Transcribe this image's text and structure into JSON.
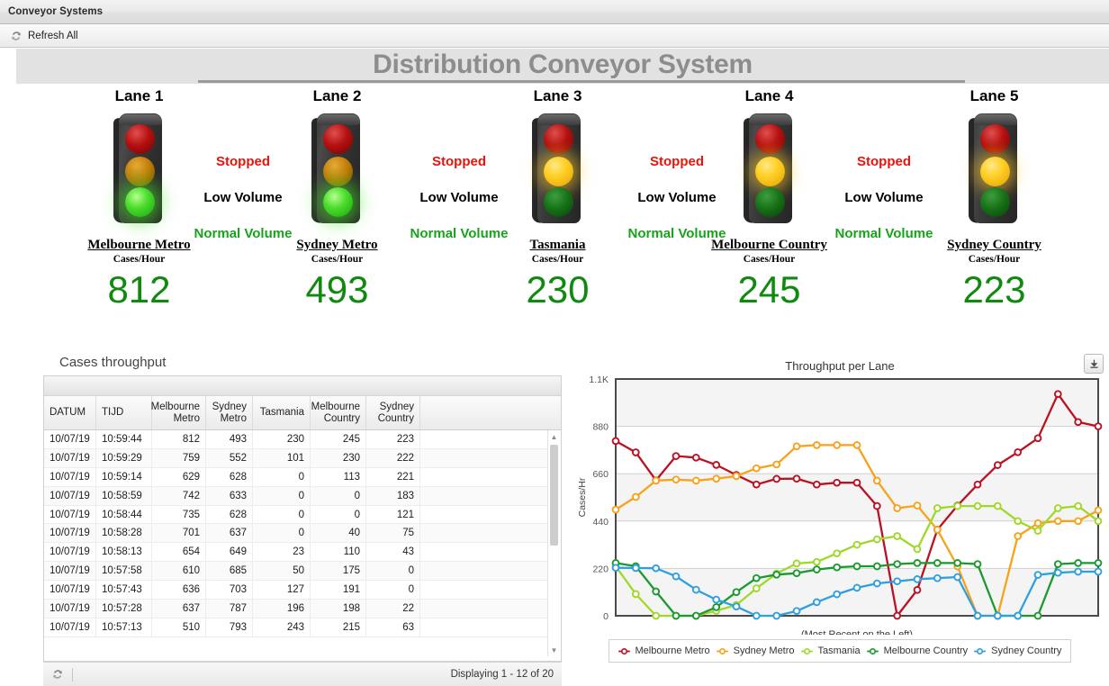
{
  "window": {
    "title": "Conveyor Systems"
  },
  "toolbar": {
    "refresh_all_label": "Refresh All",
    "refresh_icon": "refresh-icon"
  },
  "banner": {
    "title": "Distribution Conveyor System"
  },
  "lanes": [
    {
      "lane_label": "Lane 1",
      "name": "Melbourne Metro",
      "unit": "Cases/Hour",
      "value": "812",
      "signal": "green",
      "statuses": {
        "stopped": "Stopped",
        "low": "Low Volume",
        "normal": "Normal Volume"
      }
    },
    {
      "lane_label": "Lane 2",
      "name": "Sydney Metro",
      "unit": "Cases/Hour",
      "value": "493",
      "signal": "green",
      "statuses": {
        "stopped": "Stopped",
        "low": "Low Volume",
        "normal": "Normal Volume"
      }
    },
    {
      "lane_label": "Lane 3",
      "name": "Tasmania",
      "unit": "Cases/Hour",
      "value": "230",
      "signal": "amber",
      "statuses": {
        "stopped": "Stopped",
        "low": "Low Volume",
        "normal": "Normal Volume"
      }
    },
    {
      "lane_label": "Lane 4",
      "name": "Melbourne Country",
      "unit": "Cases/Hour",
      "value": "245",
      "signal": "amber",
      "statuses": {
        "stopped": "Stopped",
        "low": "Low Volume",
        "normal": "Normal Volume"
      }
    },
    {
      "lane_label": "Lane 5",
      "name": "Sydney Country",
      "unit": "Cases/Hour",
      "value": "223",
      "signal": "amber",
      "statuses": {
        "stopped": "Stopped",
        "low": "Low Volume",
        "normal": "Normal Volume"
      }
    }
  ],
  "grid": {
    "title": "Cases throughput",
    "columns": [
      "DATUM",
      "TIJD",
      "Melbourne Metro",
      "Sydney Metro",
      "Tasmania",
      "Melbourne Country",
      "Sydney Country"
    ],
    "rows": [
      [
        "10/07/19",
        "10:59:44",
        "812",
        "493",
        "230",
        "245",
        "223"
      ],
      [
        "10/07/19",
        "10:59:29",
        "759",
        "552",
        "101",
        "230",
        "222"
      ],
      [
        "10/07/19",
        "10:59:14",
        "629",
        "628",
        "0",
        "113",
        "221"
      ],
      [
        "10/07/19",
        "10:58:59",
        "742",
        "633",
        "0",
        "0",
        "183"
      ],
      [
        "10/07/19",
        "10:58:44",
        "735",
        "628",
        "0",
        "0",
        "121"
      ],
      [
        "10/07/19",
        "10:58:28",
        "701",
        "637",
        "0",
        "40",
        "75"
      ],
      [
        "10/07/19",
        "10:58:13",
        "654",
        "649",
        "23",
        "110",
        "43"
      ],
      [
        "10/07/19",
        "10:57:58",
        "610",
        "685",
        "50",
        "175",
        "0"
      ],
      [
        "10/07/19",
        "10:57:43",
        "636",
        "703",
        "127",
        "191",
        "0"
      ],
      [
        "10/07/19",
        "10:57:28",
        "637",
        "787",
        "196",
        "198",
        "22"
      ],
      [
        "10/07/19",
        "10:57:13",
        "510",
        "793",
        "243",
        "215",
        "63"
      ]
    ],
    "footer": {
      "status": "Displaying 1 - 12 of 20",
      "refresh_icon": "refresh-icon"
    },
    "scrollbar": {
      "up_icon": "scroll-up-icon",
      "down_icon": "scroll-down-icon"
    }
  },
  "chart_panel": {
    "export_icon": "download-icon"
  },
  "chart_data": {
    "type": "line",
    "title": "Throughput per Lane",
    "xlabel": "(Most Recent on the Left)",
    "ylabel": "Cases/Hr",
    "ylim": [
      0,
      1100
    ],
    "yticks": [
      0,
      220,
      440,
      660,
      880,
      1100
    ],
    "ytick_labels": [
      "0",
      "220",
      "440",
      "660",
      "880",
      "1.1K"
    ],
    "grid": true,
    "legend_position": "bottom",
    "x": [
      1,
      2,
      3,
      4,
      5,
      6,
      7,
      8,
      9,
      10,
      11,
      12,
      13,
      14,
      15,
      16,
      17,
      18,
      19,
      20,
      21,
      22,
      23,
      24,
      25
    ],
    "series": [
      {
        "name": "Melbourne Metro",
        "color": "#bb1122",
        "values": [
          812,
          759,
          629,
          742,
          735,
          701,
          654,
          610,
          636,
          637,
          610,
          618,
          618,
          510,
          0,
          120,
          400,
          512,
          610,
          700,
          760,
          825,
          1030,
          900,
          880
        ]
      },
      {
        "name": "Sydney Metro",
        "color": "#f7a219",
        "values": [
          493,
          552,
          628,
          633,
          628,
          637,
          649,
          685,
          703,
          787,
          793,
          793,
          793,
          628,
          500,
          512,
          400,
          230,
          0,
          0,
          370,
          430,
          440,
          440,
          490
        ]
      },
      {
        "name": "Tasmania",
        "color": "#a0d82a",
        "values": [
          230,
          101,
          0,
          0,
          0,
          23,
          50,
          127,
          196,
          243,
          250,
          290,
          330,
          355,
          370,
          310,
          500,
          510,
          510,
          510,
          440,
          395,
          500,
          510,
          440
        ]
      },
      {
        "name": "Melbourne Country",
        "color": "#1a9a2e",
        "values": [
          245,
          230,
          113,
          0,
          0,
          40,
          110,
          175,
          191,
          198,
          215,
          225,
          230,
          230,
          240,
          245,
          245,
          245,
          240,
          0,
          0,
          0,
          240,
          245,
          245
        ]
      },
      {
        "name": "Sydney Country",
        "color": "#2f9fe0",
        "values": [
          223,
          222,
          221,
          183,
          121,
          75,
          43,
          0,
          0,
          22,
          63,
          100,
          130,
          150,
          160,
          170,
          175,
          180,
          0,
          0,
          0,
          190,
          200,
          205,
          205
        ]
      }
    ]
  }
}
